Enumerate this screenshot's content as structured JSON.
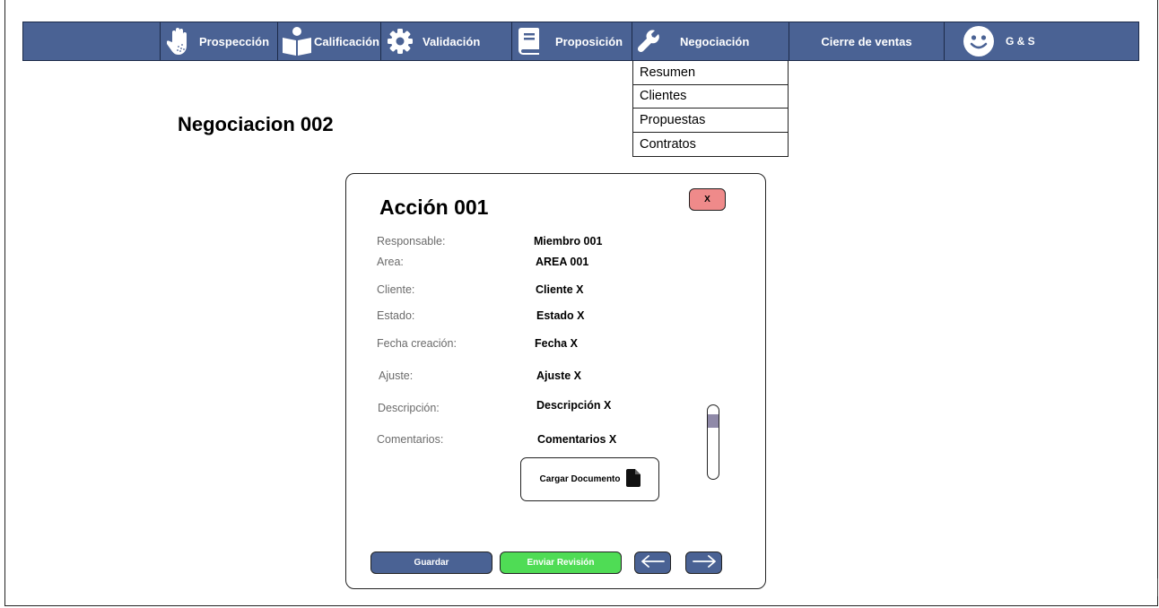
{
  "nav": {
    "items": [
      {
        "label": "Prospección",
        "icon": "hand-icon"
      },
      {
        "label": "Calificación",
        "icon": "reader-icon"
      },
      {
        "label": "Validación",
        "icon": "gear-icon"
      },
      {
        "label": "Proposición",
        "icon": "book-icon"
      },
      {
        "label": "Negociación",
        "icon": "wrench-icon"
      },
      {
        "label": "Cierre de ventas"
      },
      {
        "label": "G & S",
        "icon": "smiley-icon"
      }
    ],
    "bar_color": "#4a6294"
  },
  "dropdown": {
    "items": [
      "Resumen",
      "Clientes",
      "Propuestas",
      "Contratos"
    ]
  },
  "page": {
    "title": "Negociacion 002"
  },
  "modal": {
    "title": "Acción 001",
    "close_label": "X",
    "fields": [
      {
        "label": "Responsable:",
        "value": "Miembro 001"
      },
      {
        "label": "Area:",
        "value": "AREA 001"
      },
      {
        "label": "Cliente:",
        "value": "Cliente X"
      },
      {
        "label": "Estado:",
        "value": "Estado X"
      },
      {
        "label": "Fecha creación:",
        "value": "Fecha X"
      },
      {
        "label": "Ajuste:",
        "value": "Ajuste X"
      },
      {
        "label": "Descripción:",
        "value": "Descripción X"
      },
      {
        "label": "Comentarios:",
        "value": "Comentarios X"
      }
    ],
    "upload_label": "Cargar Documento",
    "save_label": "Guardar",
    "review_label": "Enviar Revisión",
    "prev_icon": "arrow-left-icon",
    "next_icon": "arrow-right-icon",
    "colors": {
      "close": "#ef8a8a",
      "save": "#4a6294",
      "review": "#4fdc55"
    }
  }
}
